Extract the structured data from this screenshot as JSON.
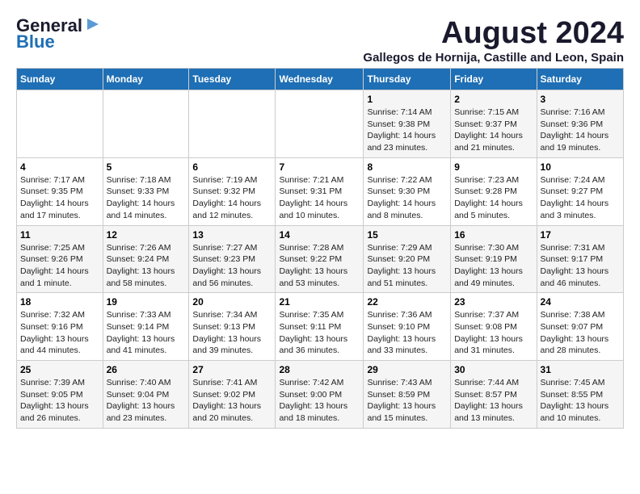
{
  "logo": {
    "line1": "General",
    "line2": "Blue"
  },
  "title": "August 2024",
  "subtitle": "Gallegos de Hornija, Castille and Leon, Spain",
  "headers": [
    "Sunday",
    "Monday",
    "Tuesday",
    "Wednesday",
    "Thursday",
    "Friday",
    "Saturday"
  ],
  "weeks": [
    [
      {
        "day": "",
        "info": ""
      },
      {
        "day": "",
        "info": ""
      },
      {
        "day": "",
        "info": ""
      },
      {
        "day": "",
        "info": ""
      },
      {
        "day": "1",
        "info": "Sunrise: 7:14 AM\nSunset: 9:38 PM\nDaylight: 14 hours and 23 minutes."
      },
      {
        "day": "2",
        "info": "Sunrise: 7:15 AM\nSunset: 9:37 PM\nDaylight: 14 hours and 21 minutes."
      },
      {
        "day": "3",
        "info": "Sunrise: 7:16 AM\nSunset: 9:36 PM\nDaylight: 14 hours and 19 minutes."
      }
    ],
    [
      {
        "day": "4",
        "info": "Sunrise: 7:17 AM\nSunset: 9:35 PM\nDaylight: 14 hours and 17 minutes."
      },
      {
        "day": "5",
        "info": "Sunrise: 7:18 AM\nSunset: 9:33 PM\nDaylight: 14 hours and 14 minutes."
      },
      {
        "day": "6",
        "info": "Sunrise: 7:19 AM\nSunset: 9:32 PM\nDaylight: 14 hours and 12 minutes."
      },
      {
        "day": "7",
        "info": "Sunrise: 7:21 AM\nSunset: 9:31 PM\nDaylight: 14 hours and 10 minutes."
      },
      {
        "day": "8",
        "info": "Sunrise: 7:22 AM\nSunset: 9:30 PM\nDaylight: 14 hours and 8 minutes."
      },
      {
        "day": "9",
        "info": "Sunrise: 7:23 AM\nSunset: 9:28 PM\nDaylight: 14 hours and 5 minutes."
      },
      {
        "day": "10",
        "info": "Sunrise: 7:24 AM\nSunset: 9:27 PM\nDaylight: 14 hours and 3 minutes."
      }
    ],
    [
      {
        "day": "11",
        "info": "Sunrise: 7:25 AM\nSunset: 9:26 PM\nDaylight: 14 hours and 1 minute."
      },
      {
        "day": "12",
        "info": "Sunrise: 7:26 AM\nSunset: 9:24 PM\nDaylight: 13 hours and 58 minutes."
      },
      {
        "day": "13",
        "info": "Sunrise: 7:27 AM\nSunset: 9:23 PM\nDaylight: 13 hours and 56 minutes."
      },
      {
        "day": "14",
        "info": "Sunrise: 7:28 AM\nSunset: 9:22 PM\nDaylight: 13 hours and 53 minutes."
      },
      {
        "day": "15",
        "info": "Sunrise: 7:29 AM\nSunset: 9:20 PM\nDaylight: 13 hours and 51 minutes."
      },
      {
        "day": "16",
        "info": "Sunrise: 7:30 AM\nSunset: 9:19 PM\nDaylight: 13 hours and 49 minutes."
      },
      {
        "day": "17",
        "info": "Sunrise: 7:31 AM\nSunset: 9:17 PM\nDaylight: 13 hours and 46 minutes."
      }
    ],
    [
      {
        "day": "18",
        "info": "Sunrise: 7:32 AM\nSunset: 9:16 PM\nDaylight: 13 hours and 44 minutes."
      },
      {
        "day": "19",
        "info": "Sunrise: 7:33 AM\nSunset: 9:14 PM\nDaylight: 13 hours and 41 minutes."
      },
      {
        "day": "20",
        "info": "Sunrise: 7:34 AM\nSunset: 9:13 PM\nDaylight: 13 hours and 39 minutes."
      },
      {
        "day": "21",
        "info": "Sunrise: 7:35 AM\nSunset: 9:11 PM\nDaylight: 13 hours and 36 minutes."
      },
      {
        "day": "22",
        "info": "Sunrise: 7:36 AM\nSunset: 9:10 PM\nDaylight: 13 hours and 33 minutes."
      },
      {
        "day": "23",
        "info": "Sunrise: 7:37 AM\nSunset: 9:08 PM\nDaylight: 13 hours and 31 minutes."
      },
      {
        "day": "24",
        "info": "Sunrise: 7:38 AM\nSunset: 9:07 PM\nDaylight: 13 hours and 28 minutes."
      }
    ],
    [
      {
        "day": "25",
        "info": "Sunrise: 7:39 AM\nSunset: 9:05 PM\nDaylight: 13 hours and 26 minutes."
      },
      {
        "day": "26",
        "info": "Sunrise: 7:40 AM\nSunset: 9:04 PM\nDaylight: 13 hours and 23 minutes."
      },
      {
        "day": "27",
        "info": "Sunrise: 7:41 AM\nSunset: 9:02 PM\nDaylight: 13 hours and 20 minutes."
      },
      {
        "day": "28",
        "info": "Sunrise: 7:42 AM\nSunset: 9:00 PM\nDaylight: 13 hours and 18 minutes."
      },
      {
        "day": "29",
        "info": "Sunrise: 7:43 AM\nSunset: 8:59 PM\nDaylight: 13 hours and 15 minutes."
      },
      {
        "day": "30",
        "info": "Sunrise: 7:44 AM\nSunset: 8:57 PM\nDaylight: 13 hours and 13 minutes."
      },
      {
        "day": "31",
        "info": "Sunrise: 7:45 AM\nSunset: 8:55 PM\nDaylight: 13 hours and 10 minutes."
      }
    ]
  ]
}
